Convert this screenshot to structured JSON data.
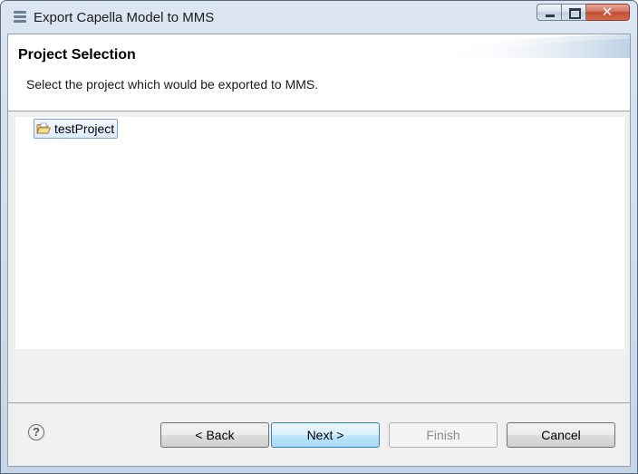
{
  "window": {
    "title": "Export Capella Model to MMS",
    "icon": "menu-lines-icon",
    "caption_buttons": [
      "minimize-icon",
      "maximize-icon",
      "close-icon"
    ],
    "close_glyph": "✕"
  },
  "page": {
    "title": "Project Selection",
    "description": "Select the project which would be exported to MMS."
  },
  "tree": {
    "items": [
      {
        "label": "testProject",
        "icon": "open-project-folder-icon",
        "selected": true
      }
    ]
  },
  "footer": {
    "help_glyph": "?",
    "help_icon": "help-icon",
    "buttons": {
      "back": "< Back",
      "next": "Next >",
      "finish": "Finish",
      "cancel": "Cancel"
    }
  },
  "colors": {
    "selection_border": "#7da2ce",
    "selection_fill": "#dcebfc",
    "default_button_border": "#3c7fb1",
    "close_button": "#c24a33"
  }
}
